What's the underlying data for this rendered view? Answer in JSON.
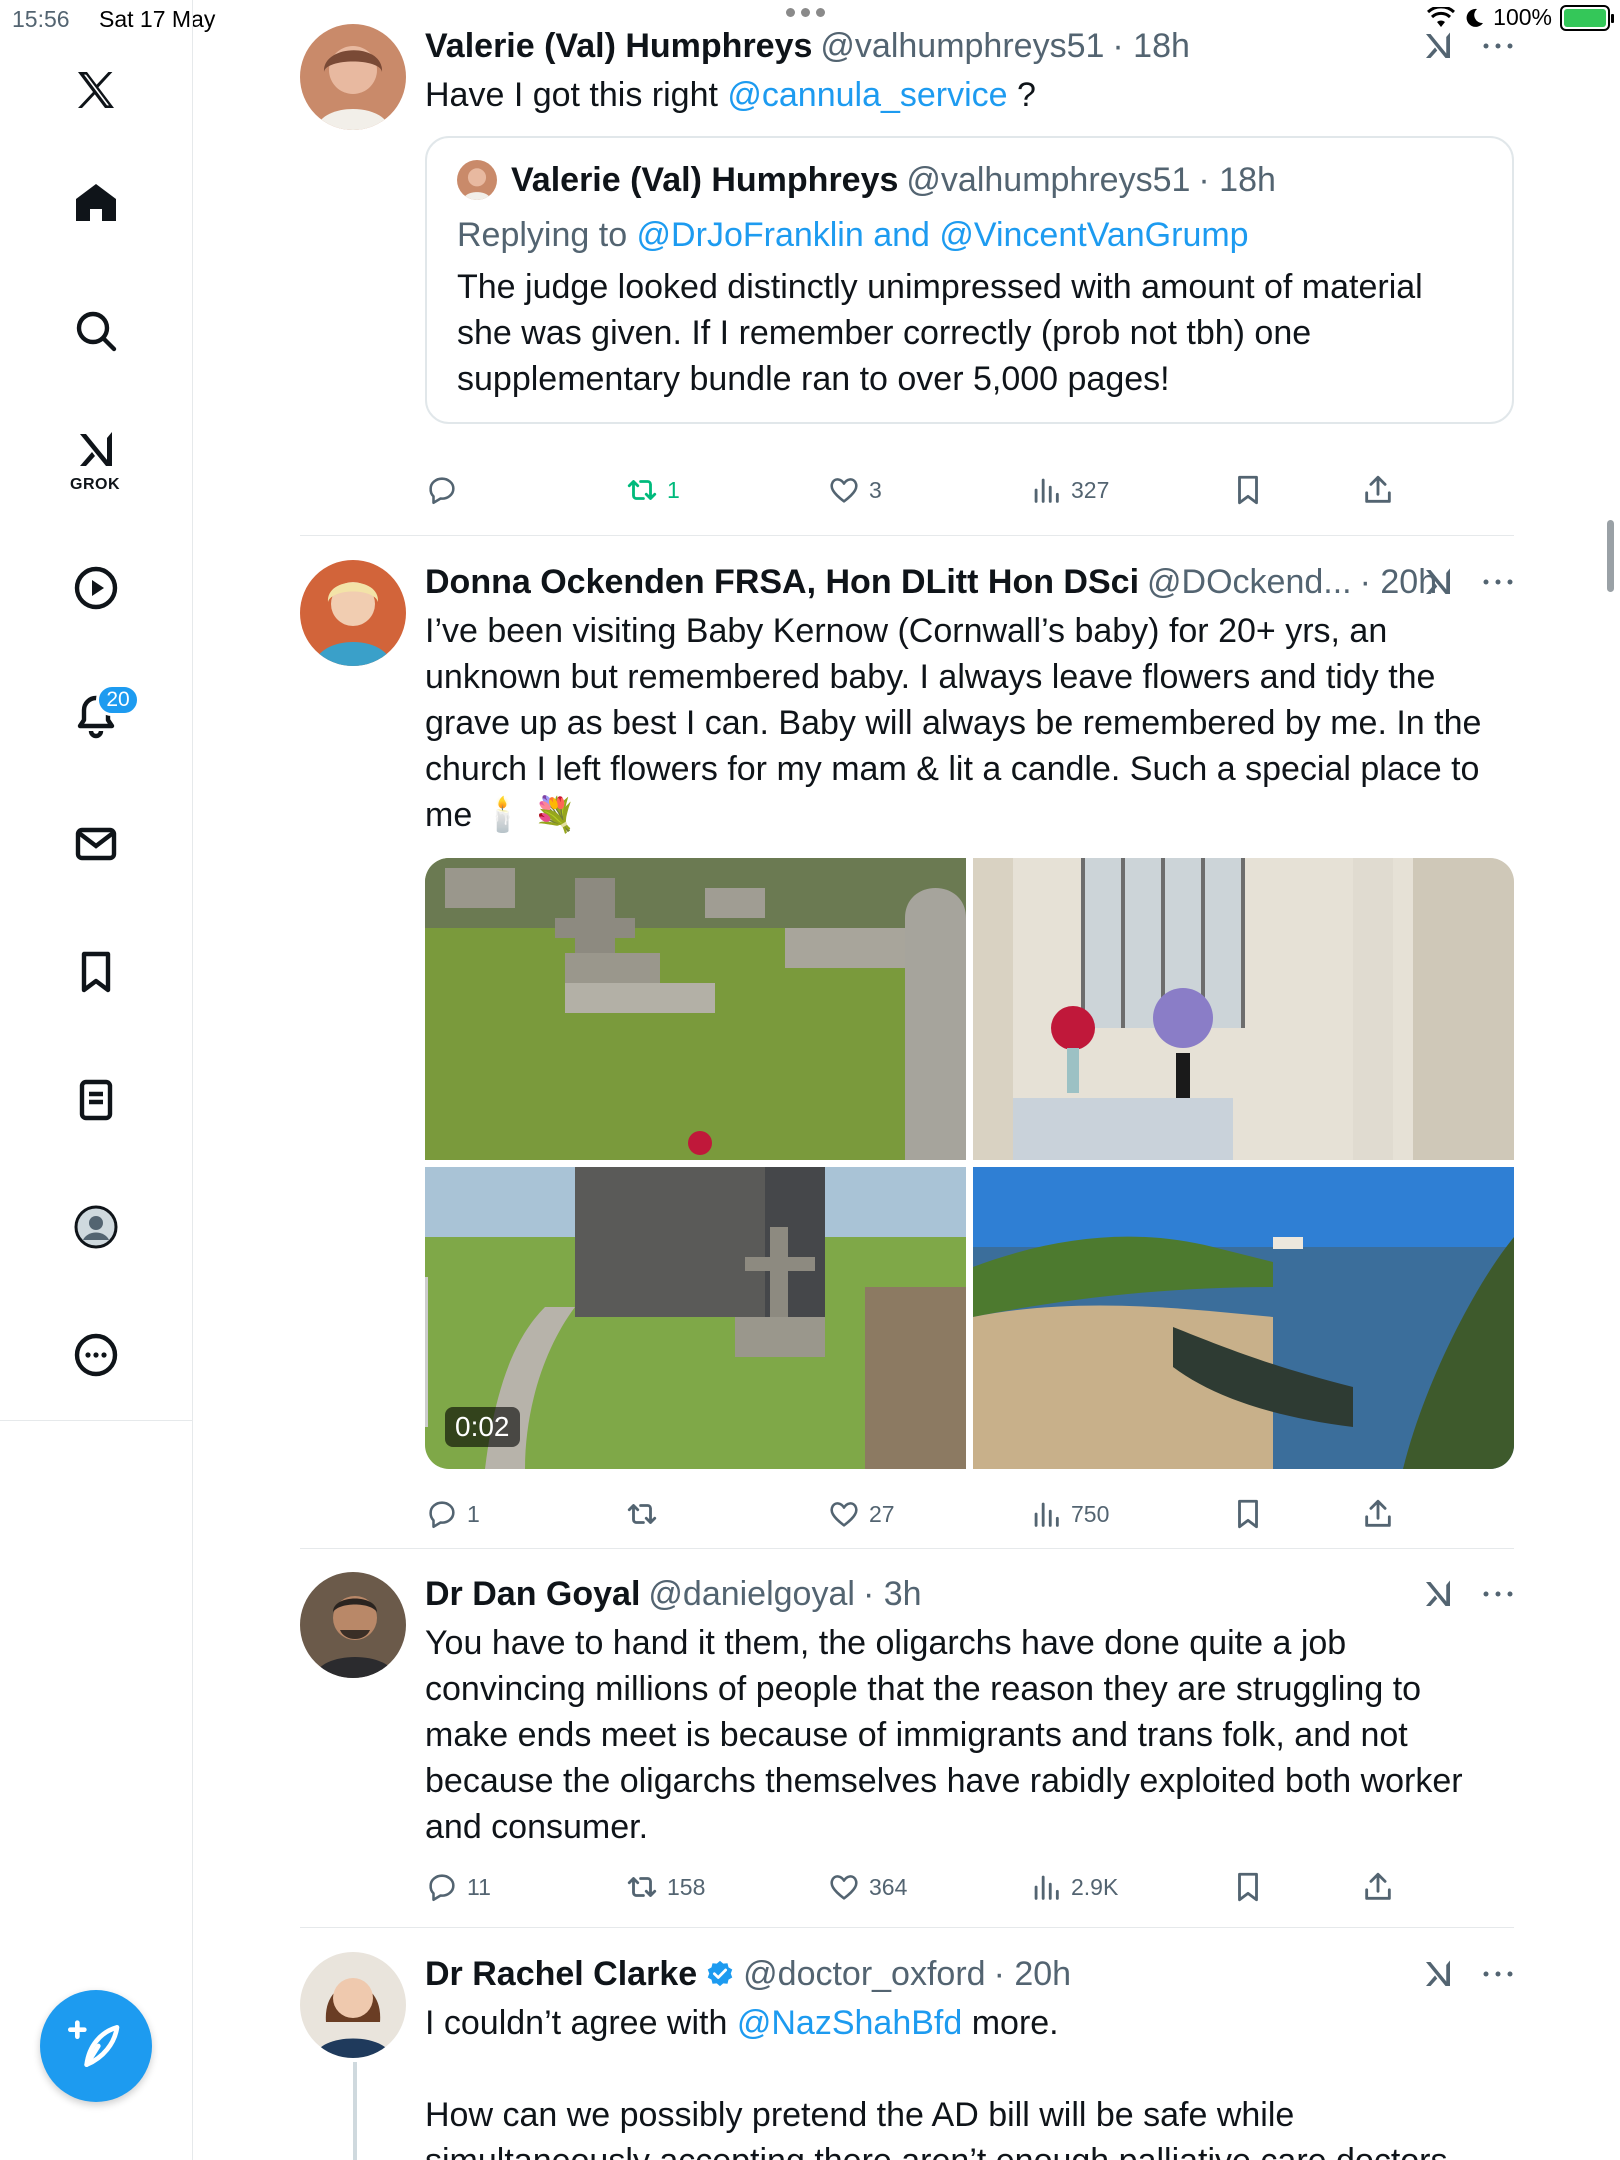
{
  "status_bar": {
    "time": "15:56",
    "date": "Sat 17 May",
    "battery": "100%"
  },
  "sidebar": {
    "items": [
      {
        "name": "home",
        "icon": "home-icon"
      },
      {
        "name": "explore",
        "icon": "search-icon"
      },
      {
        "name": "grok",
        "icon": "grok-icon",
        "label": "GROK"
      },
      {
        "name": "video",
        "icon": "play-icon"
      },
      {
        "name": "notifications",
        "icon": "bell-icon",
        "badge": "20"
      },
      {
        "name": "messages",
        "icon": "mail-icon"
      },
      {
        "name": "bookmarks",
        "icon": "bookmark-icon"
      },
      {
        "name": "lists",
        "icon": "list-icon"
      },
      {
        "name": "profile",
        "icon": "person-icon"
      },
      {
        "name": "more",
        "icon": "more-icon"
      }
    ],
    "compose_icon": "compose-icon"
  },
  "posts": [
    {
      "name": "Valerie (Val) Humphreys",
      "handle": "@valhumphreys51",
      "time": "· 18h",
      "text_before": "Have I got this right ",
      "text_link": "@cannula_service",
      "text_after": " ?",
      "quote": {
        "name": "Valerie (Val) Humphreys",
        "handle": "@valhumphreys51",
        "time": "· 18h",
        "replying_prefix": "Replying to ",
        "replying_to": "@DrJoFranklin and @VincentVanGrump",
        "text": "The judge looked distinctly unimpressed with amount of material she was given. If I remember correctly (prob not tbh) one supplementary bundle ran to over 5,000 pages!"
      },
      "replies": "",
      "reposts": "1",
      "likes": "3",
      "views": "327"
    },
    {
      "name": "Donna Ockenden FRSA, Hon DLitt Hon DSci",
      "handle": "@DOckend...",
      "time": "· 20h",
      "text": "I’ve been visiting Baby Kernow (Cornwall’s baby) for 20+ yrs, an unknown but remembered baby. I always leave flowers and tidy the grave up as best I can. Baby will always be remembered by me. In the church I left flowers for my mam & lit a candle. Such a special place to me 🕯️ 💐",
      "video_duration": "0:02",
      "replies": "1",
      "reposts": "",
      "likes": "27",
      "views": "750"
    },
    {
      "name": "Dr Dan Goyal",
      "handle": "@danielgoyal",
      "time": "· 3h",
      "text": "You have to hand it them, the oligarchs have done quite a job convincing millions of people that the reason they are struggling to make ends meet is because of immigrants and trans folk, and not because the oligarchs themselves have rabidly exploited both worker and consumer.",
      "replies": "11",
      "reposts": "158",
      "likes": "364",
      "views": "2.9K"
    },
    {
      "name": "Dr Rachel Clarke",
      "handle": "@doctor_oxford",
      "time": "· 20h",
      "text_before": "I couldn’t agree with ",
      "text_link": "@NazShahBfd",
      "text_after": " more.",
      "text2": "How can we possibly pretend the AD bill will be safe while simultaneously accepting there aren’t enough palliative care doctors"
    }
  ],
  "colors": {
    "accent": "#1d9bf0",
    "repost_active": "#00ba7c",
    "muted": "#536471"
  }
}
